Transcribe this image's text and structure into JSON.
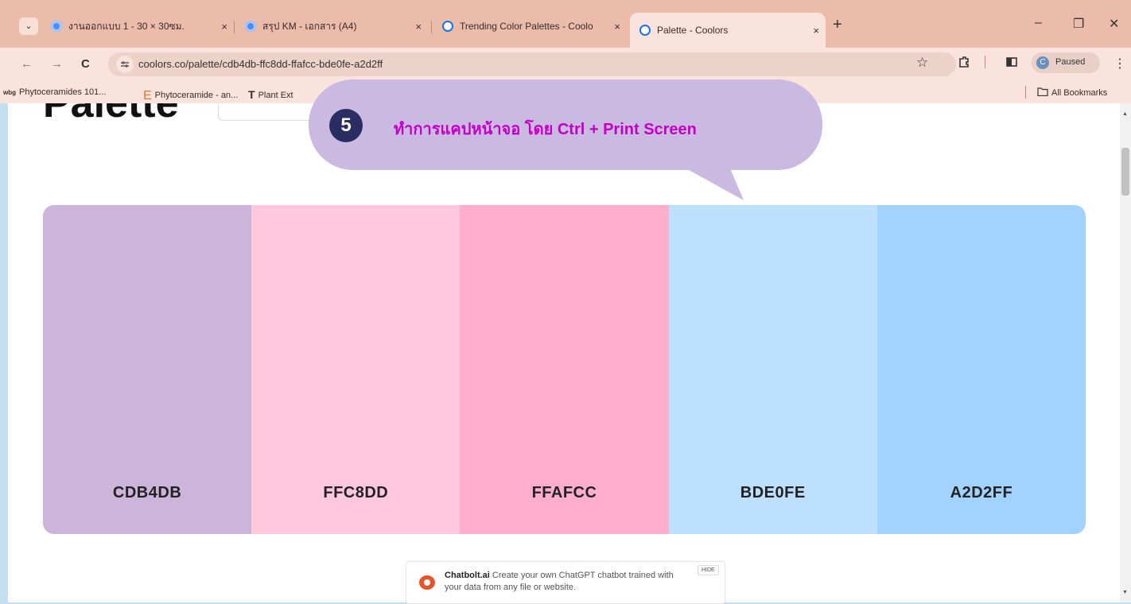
{
  "browser": {
    "tabs": [
      {
        "title": "งานออกแบบ 1 - 30 × 30ซม.",
        "close": "×"
      },
      {
        "title": "สรุป KM - เอกสาร (A4)",
        "close": "×"
      },
      {
        "title": "Trending Color Palettes - Coolo",
        "close": "×"
      },
      {
        "title": "Palette - Coolors",
        "close": "×"
      }
    ],
    "new_tab": "+",
    "tab_menu": "⌄",
    "window_controls": {
      "minimize": "–",
      "restore": "❐",
      "close": "✕"
    },
    "nav": {
      "back": "←",
      "forward": "→",
      "reload": "C"
    },
    "url": "coolors.co/palette/cdb4db-ffc8dd-ffafcc-bde0fe-a2d2ff",
    "site_info_icon": "tune-icon",
    "star": "☆",
    "profile": {
      "initial": "C",
      "status": "Paused"
    },
    "menu": "⋮",
    "bookmarks": [
      {
        "icon": "wbg",
        "label": "Phytoceramides 101..."
      },
      {
        "icon": "E",
        "label": "Phytoceramide - an..."
      },
      {
        "icon": "T",
        "label": "Plant Ext"
      }
    ],
    "all_bookmarks": "All Bookmarks"
  },
  "page": {
    "heading": "Palette",
    "palette": [
      {
        "code": "CDB4DB",
        "color": "#cdb4db"
      },
      {
        "code": "FFC8DD",
        "color": "#ffc8dd"
      },
      {
        "code": "FFAFCC",
        "color": "#ffafcc"
      },
      {
        "code": "BDE0FE",
        "color": "#bde0fe"
      },
      {
        "code": "A2D2FF",
        "color": "#a2d2ff"
      }
    ],
    "ad": {
      "brand": "Chatbolt.ai",
      "text": "Create your own ChatGPT chatbot trained with your data from any file or website.",
      "hide": "HIDE"
    }
  },
  "callout": {
    "step": "5",
    "text": "ทำการแคปหน้าจอ โดย Ctrl + Print Screen",
    "bg_color": "#cab9e0",
    "text_color": "#c400c8",
    "badge_color": "#2a2d62"
  }
}
